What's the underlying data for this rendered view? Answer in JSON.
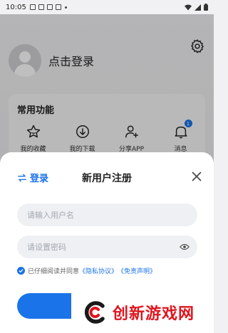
{
  "status_bar": {
    "time": "10:05"
  },
  "profile": {
    "login_prompt": "点击登录"
  },
  "common_features": {
    "title": "常用功能",
    "items": [
      {
        "label": "我的收藏",
        "icon": "star-icon"
      },
      {
        "label": "我的下载",
        "icon": "download-icon"
      },
      {
        "label": "分享APP",
        "icon": "share-user-icon"
      },
      {
        "label": "消息",
        "icon": "bell-icon",
        "badge": "1"
      }
    ]
  },
  "register_sheet": {
    "switch_label": "登录",
    "title": "新用户注册",
    "username_placeholder": "请输入用户名",
    "password_placeholder": "请设置密码",
    "agree_prefix": "已仔细阅读并同意",
    "privacy_link": "《隐私协议》",
    "disclaimer_link": "《免责声明》"
  },
  "watermark": {
    "text": "创新游戏网"
  },
  "colors": {
    "accent": "#1a73e8",
    "watermark": "#e0141e"
  }
}
